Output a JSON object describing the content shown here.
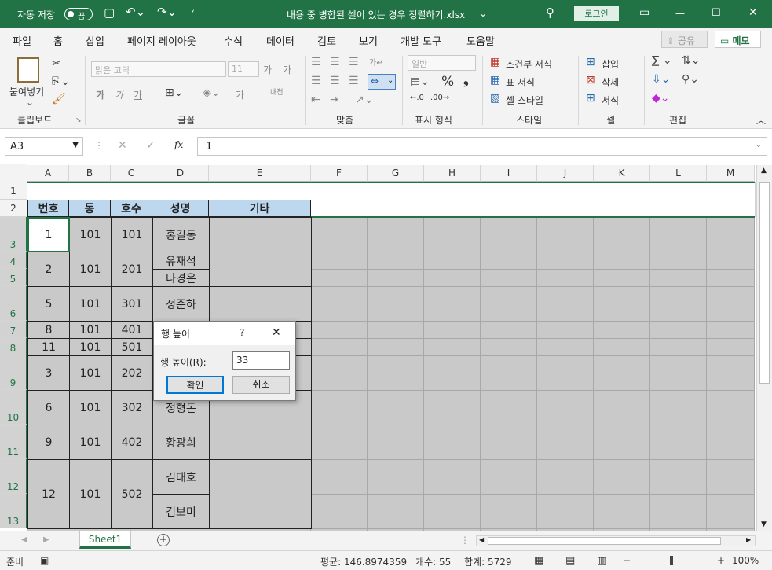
{
  "titlebar": {
    "autosave": "자동 저장",
    "toggle": "끔",
    "title": "내용 중 병합된 셀이 있는 경우 정렬하기.xlsx",
    "title_caret": "⌄",
    "login": "로그인"
  },
  "menu": {
    "tabs": [
      "파일",
      "홈",
      "삽입",
      "페이지 레이아웃",
      "수식",
      "데이터",
      "검토",
      "보기",
      "개발 도구",
      "도움말"
    ],
    "share": "공유",
    "memo": "메모"
  },
  "ribbon": {
    "clipboard": {
      "paste": "붙여넣기",
      "group": "클립보드"
    },
    "font": {
      "name": "맑은 고딕",
      "size": "11",
      "group": "글꼴",
      "bold": "가",
      "italic": "가",
      "underline": "가",
      "grow": "가",
      "shrink": "가",
      "color_a": "가",
      "phonetic": "내천"
    },
    "align": {
      "group": "맞춤"
    },
    "number": {
      "format": "일반",
      "group": "표시 형식",
      "percent": "%",
      "comma": "❟"
    },
    "styles": {
      "cond": "조건부 서식",
      "table": "표 서식",
      "cell": "셀 스타일",
      "group": "스타일"
    },
    "cells": {
      "insert": "삽입",
      "delete": "삭제",
      "format": "서식",
      "group": "셀"
    },
    "edit": {
      "group": "편집"
    }
  },
  "formula": {
    "namebox": "A3",
    "fx": "fx",
    "value": "1"
  },
  "columns": [
    "A",
    "B",
    "C",
    "D",
    "E",
    "F",
    "G",
    "H",
    "I",
    "J",
    "K",
    "L",
    "M"
  ],
  "rows": [
    "1",
    "2",
    "3",
    "4",
    "5",
    "6",
    "7",
    "8",
    "9",
    "10",
    "11",
    "12",
    "13"
  ],
  "table": {
    "headers": [
      "번호",
      "동",
      "호수",
      "성명",
      "기타"
    ],
    "r3": {
      "a": "1",
      "b": "101",
      "c": "101",
      "d": "홍길동"
    },
    "r4": {
      "a": "2",
      "b": "101",
      "c": "201",
      "d1": "유재석",
      "d2": "나경은"
    },
    "r6": {
      "a": "5",
      "b": "101",
      "c": "301",
      "d": "정준하"
    },
    "r7": {
      "a": "8",
      "b": "101",
      "c": "401"
    },
    "r8": {
      "a": "11",
      "b": "101",
      "c": "501"
    },
    "r9": {
      "a": "3",
      "b": "101",
      "c": "202"
    },
    "r10": {
      "a": "6",
      "b": "101",
      "c": "302",
      "d": "정형돈"
    },
    "r11": {
      "a": "9",
      "b": "101",
      "c": "402",
      "d": "황광희"
    },
    "r12": {
      "a": "12",
      "b": "101",
      "c": "502",
      "d1": "김태호",
      "d2": "김보미"
    }
  },
  "dialog": {
    "title": "행 높이",
    "help": "?",
    "close": "✕",
    "label": "행 높이(R):",
    "value": "33",
    "ok": "확인",
    "cancel": "취소"
  },
  "sheettabs": {
    "active": "Sheet1",
    "add": "+"
  },
  "status": {
    "ready": "준비",
    "avg": "평균: 146.8974359",
    "count": "개수: 55",
    "sum": "합계: 5729",
    "zoom": "100%",
    "minus": "−",
    "plus": "+"
  }
}
